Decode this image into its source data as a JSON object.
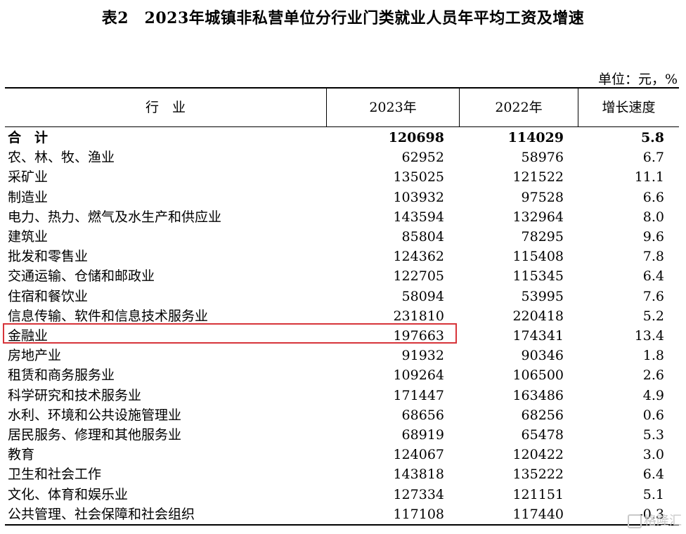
{
  "title": "表2　2023年城镇非私营单位分行业门类就业人员年平均工资及增速",
  "unit_label": "单位：元，%",
  "headers": {
    "industry": "行　业",
    "y2023": "2023年",
    "y2022": "2022年",
    "growth": "增长速度"
  },
  "total_row": {
    "name": "合　计",
    "y2023": "120698",
    "y2022": "114029",
    "growth": "5.8"
  },
  "rows": [
    {
      "name": "农、林、牧、渔业",
      "y2023": "62952",
      "y2022": "58976",
      "growth": "6.7"
    },
    {
      "name": "采矿业",
      "y2023": "135025",
      "y2022": "121522",
      "growth": "11.1"
    },
    {
      "name": "制造业",
      "y2023": "103932",
      "y2022": "97528",
      "growth": "6.6"
    },
    {
      "name": "电力、热力、燃气及水生产和供应业",
      "y2023": "143594",
      "y2022": "132964",
      "growth": "8.0"
    },
    {
      "name": "建筑业",
      "y2023": "85804",
      "y2022": "78295",
      "growth": "9.6"
    },
    {
      "name": "批发和零售业",
      "y2023": "124362",
      "y2022": "115408",
      "growth": "7.8"
    },
    {
      "name": "交通运输、仓储和邮政业",
      "y2023": "122705",
      "y2022": "115345",
      "growth": "6.4"
    },
    {
      "name": "住宿和餐饮业",
      "y2023": "58094",
      "y2022": "53995",
      "growth": "7.6"
    },
    {
      "name": "信息传输、软件和信息技术服务业",
      "y2023": "231810",
      "y2022": "220418",
      "growth": "5.2"
    },
    {
      "name": "金融业",
      "y2023": "197663",
      "y2022": "174341",
      "growth": "13.4"
    },
    {
      "name": "房地产业",
      "y2023": "91932",
      "y2022": "90346",
      "growth": "1.8"
    },
    {
      "name": "租赁和商务服务业",
      "y2023": "109264",
      "y2022": "106500",
      "growth": "2.6"
    },
    {
      "name": "科学研究和技术服务业",
      "y2023": "171447",
      "y2022": "163486",
      "growth": "4.9"
    },
    {
      "name": "水利、环境和公共设施管理业",
      "y2023": "68656",
      "y2022": "68256",
      "growth": "0.6"
    },
    {
      "name": "居民服务、修理和其他服务业",
      "y2023": "68919",
      "y2022": "65478",
      "growth": "5.3"
    },
    {
      "name": "教育",
      "y2023": "124067",
      "y2022": "120422",
      "growth": "3.0"
    },
    {
      "name": "卫生和社会工作",
      "y2023": "143818",
      "y2022": "135222",
      "growth": "6.4"
    },
    {
      "name": "文化、体育和娱乐业",
      "y2023": "127334",
      "y2022": "121151",
      "growth": "5.1"
    },
    {
      "name": "公共管理、社会保障和社会组织",
      "y2023": "117108",
      "y2022": "117440",
      "growth": "-0.3"
    }
  ],
  "highlight_color": "#d7343a",
  "watermark": "格隆汇"
}
